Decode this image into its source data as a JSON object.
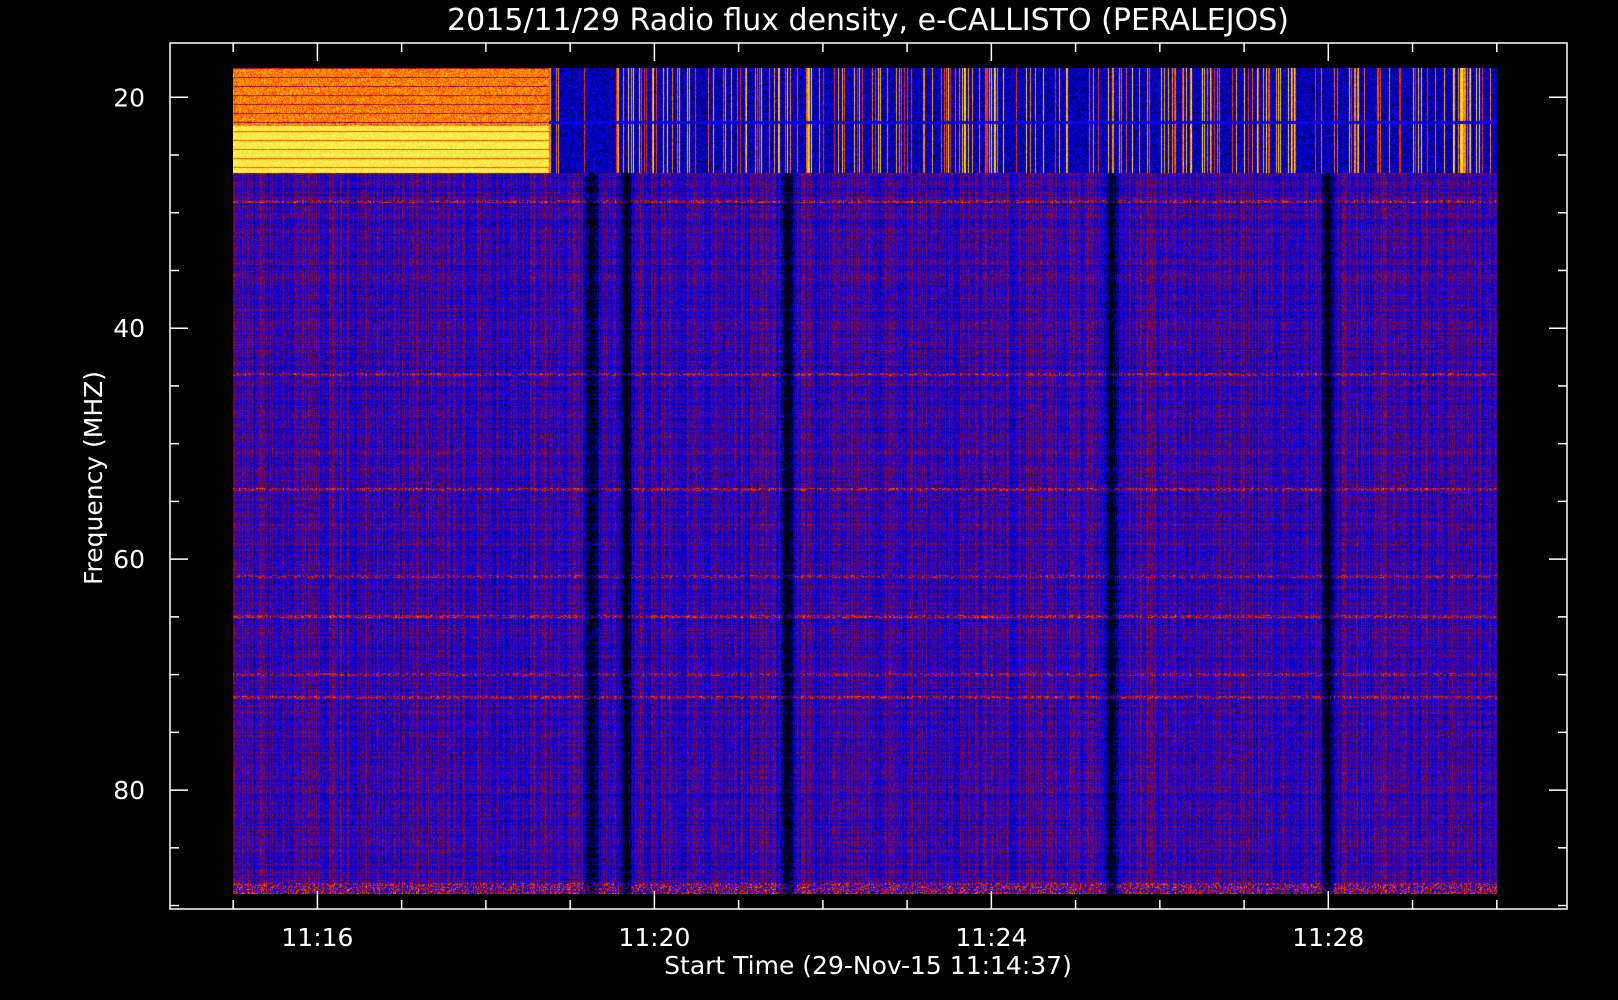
{
  "chart_data": {
    "type": "heatmap",
    "title": "2015/11/29  Radio flux density, e-CALLISTO (PERALEJOS)",
    "xlabel": "Start Time (29-Nov-15 11:14:37)",
    "ylabel": "Frequency (MHZ)",
    "x_axis": {
      "unit": "time HH:MM",
      "range": [
        "11:14:15",
        "11:30:50"
      ],
      "major_ticks": [
        "11:16",
        "11:20",
        "11:24",
        "11:28"
      ],
      "minor_tick_interval_minutes": 1
    },
    "y_axis": {
      "unit": "MHz",
      "range": [
        15.3,
        90.3
      ],
      "inverted": true,
      "major_ticks": [
        20,
        40,
        60,
        80
      ],
      "minor_tick_interval": 5
    },
    "data_extent": {
      "time": [
        "11:15:00",
        "11:30:00"
      ],
      "frequency_mhz": [
        17.5,
        89.0
      ]
    },
    "colormap": [
      "#000000",
      "#0000ff",
      "#8b0a2a",
      "#ff3000",
      "#ffb000",
      "#ffff60"
    ],
    "features": {
      "interference_bands_mhz": [
        [
          17.5,
          26.5
        ]
      ],
      "bright_band_mhz": [
        22.5,
        26.5
      ],
      "bright_band_end_time": "11:18:45",
      "dark_vertical_bands": [
        "11:19:15",
        "11:19:40",
        "11:21:35",
        "11:25:25",
        "11:28:00"
      ],
      "narrowband_lines_mhz": [
        29,
        44,
        54,
        61.5,
        65,
        70,
        72
      ]
    }
  }
}
